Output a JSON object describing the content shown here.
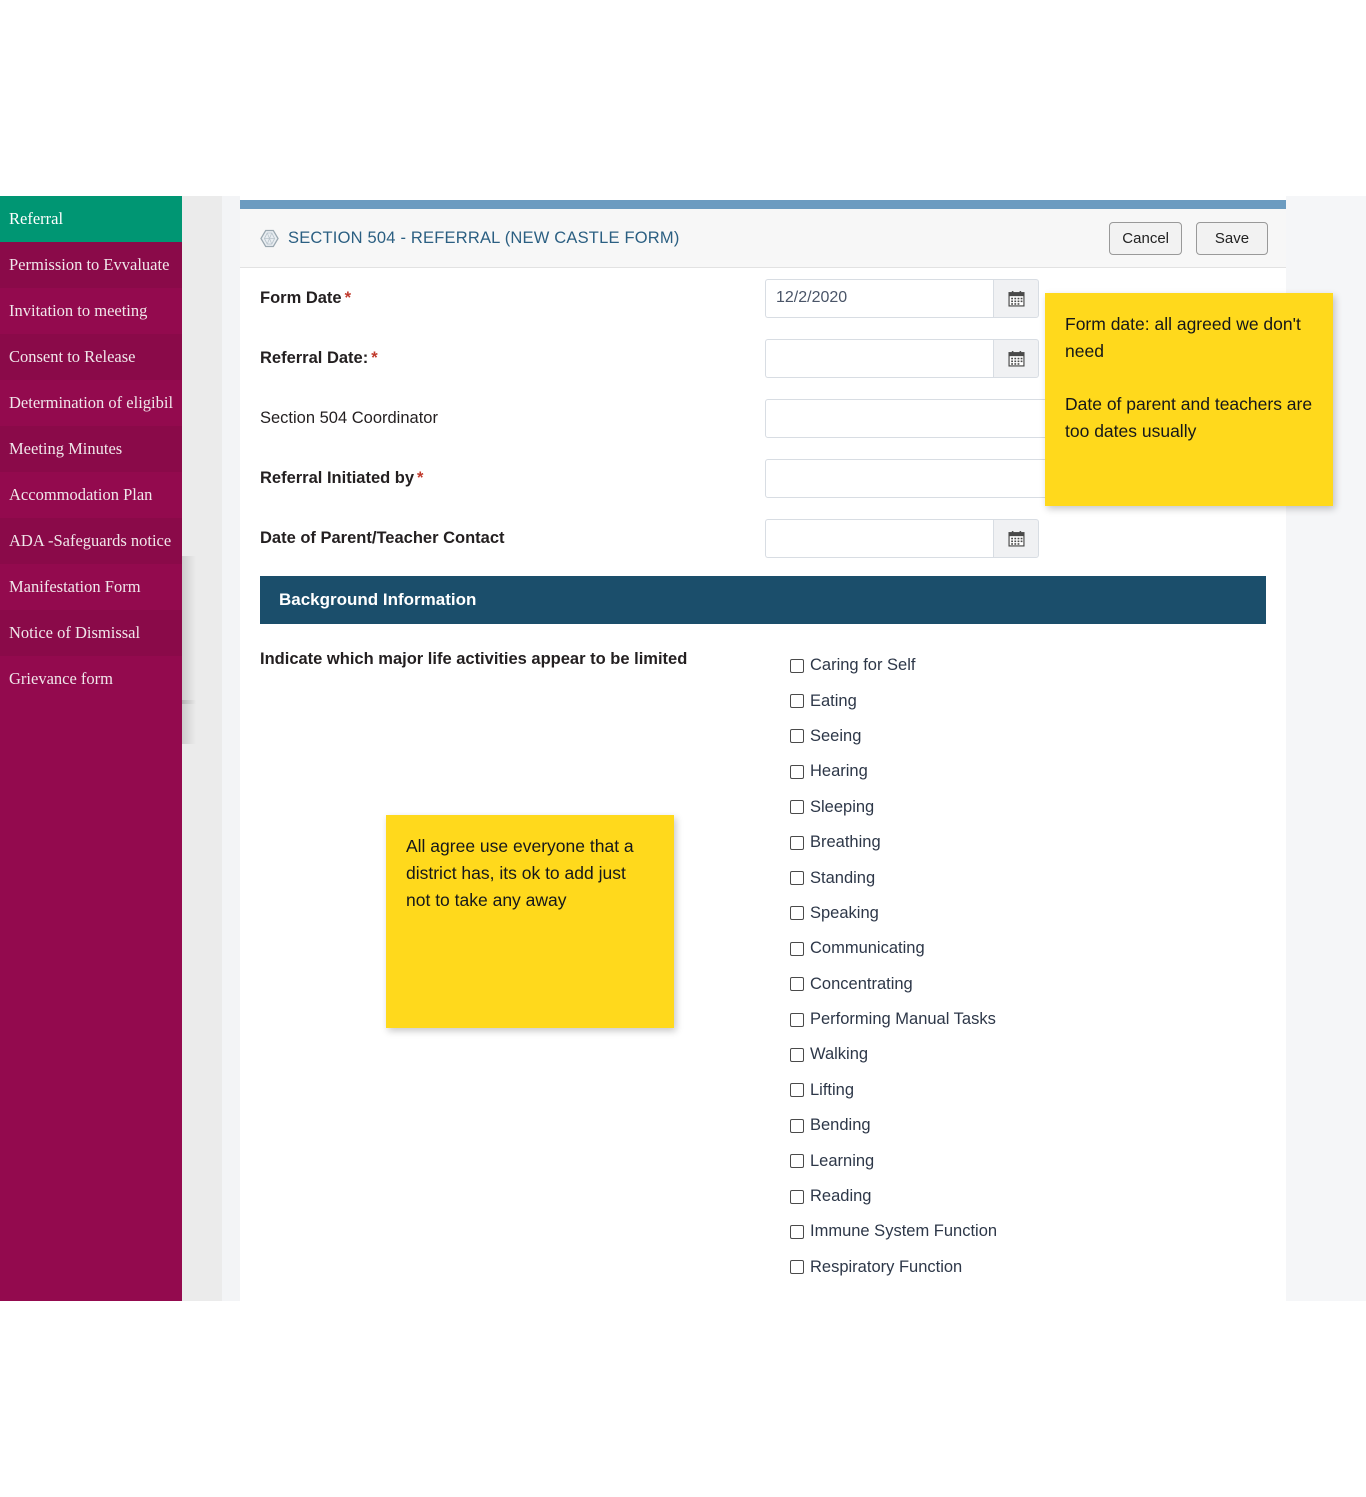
{
  "sidebar": {
    "items": [
      {
        "label": "Referral",
        "active": true
      },
      {
        "label": "Permission to Evvaluate",
        "active": false
      },
      {
        "label": "Invitation to meeting",
        "active": false
      },
      {
        "label": "Consent to Release",
        "active": false
      },
      {
        "label": "Determination of eligibil",
        "active": false
      },
      {
        "label": "Meeting Minutes",
        "active": false
      },
      {
        "label": "Accommodation Plan",
        "active": false
      },
      {
        "label": "ADA -Safeguards notice",
        "active": false
      },
      {
        "label": "Manifestation Form",
        "active": false
      },
      {
        "label": "Notice of Dismissal",
        "active": false
      },
      {
        "label": "Grievance form",
        "active": false
      }
    ],
    "colors": {
      "background": "#930a4e",
      "active_background": "#009673",
      "text": "#f0e6ea"
    }
  },
  "panel": {
    "topbar_color": "#6c9bc0",
    "header": {
      "icon": "hexagon-icon",
      "title": "SECTION 504 - REFERRAL (NEW CASTLE FORM)",
      "title_color": "#2b5f82",
      "cancel_label": "Cancel",
      "save_label": "Save"
    },
    "form_rows": [
      {
        "label": "Form Date",
        "required": true,
        "bold": true,
        "type": "date",
        "value": "12/2/2020",
        "placeholder": ""
      },
      {
        "label": "Referral Date:",
        "required": true,
        "bold": true,
        "type": "date",
        "value": "",
        "placeholder": ""
      },
      {
        "label": "Section 504 Coordinator",
        "required": false,
        "bold": false,
        "type": "text",
        "value": "",
        "placeholder": ""
      },
      {
        "label": "Referral Initiated by",
        "required": true,
        "bold": true,
        "type": "text",
        "value": "",
        "placeholder": ""
      },
      {
        "label": "Date of Parent/Teacher Contact",
        "required": false,
        "bold": true,
        "type": "date",
        "value": "",
        "placeholder": ""
      }
    ],
    "section": {
      "title": "Background Information",
      "background_color": "#1b4e6b"
    },
    "checkbox_group": {
      "question": "Indicate which major life activities appear to be limited",
      "options": [
        {
          "label": "Caring for Self",
          "checked": false
        },
        {
          "label": "Eating",
          "checked": false
        },
        {
          "label": "Seeing",
          "checked": false
        },
        {
          "label": "Hearing",
          "checked": false
        },
        {
          "label": "Sleeping",
          "checked": false
        },
        {
          "label": "Breathing",
          "checked": false
        },
        {
          "label": "Standing",
          "checked": false
        },
        {
          "label": "Speaking",
          "checked": false
        },
        {
          "label": "Communicating",
          "checked": false
        },
        {
          "label": "Concentrating",
          "checked": false
        },
        {
          "label": "Performing Manual Tasks",
          "checked": false
        },
        {
          "label": "Walking",
          "checked": false
        },
        {
          "label": "Lifting",
          "checked": false
        },
        {
          "label": "Bending",
          "checked": false
        },
        {
          "label": "Learning",
          "checked": false
        },
        {
          "label": "Reading",
          "checked": false
        },
        {
          "label": "Immune System Function",
          "checked": false
        },
        {
          "label": "Respiratory Function",
          "checked": false
        }
      ]
    }
  },
  "sticky_notes": [
    {
      "id": "sticky-top",
      "text": "Form date: all agreed we don't need\n\nDate of parent and teachers are too dates usually",
      "color": "#ffd91c"
    },
    {
      "id": "sticky-mid",
      "text": "All agree use everyone that a district has, its ok to add just not to take any away",
      "color": "#ffd91c"
    }
  ]
}
